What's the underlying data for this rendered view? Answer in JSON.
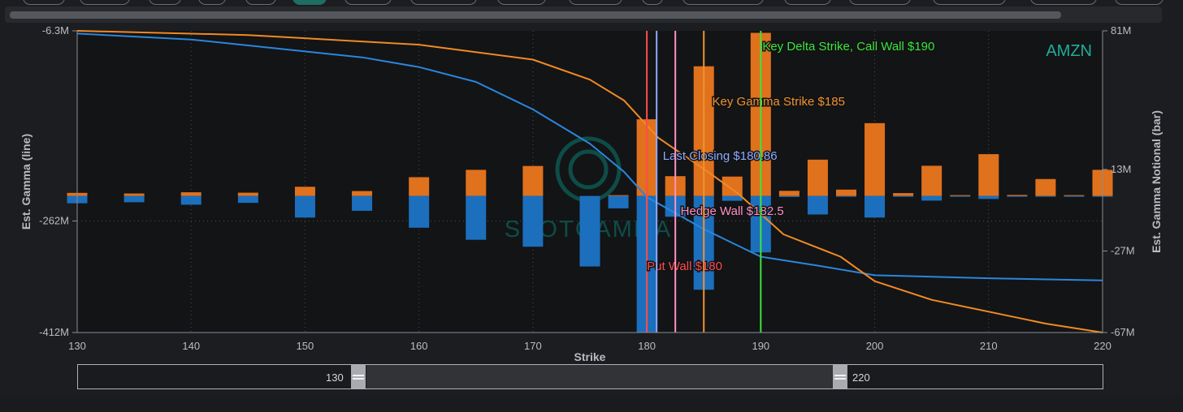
{
  "ticker": "AMZN",
  "watermark": "SPOTGAMMA",
  "navigator": {
    "min_label": "130",
    "max_label": "220"
  },
  "chart_data": {
    "type": "bar",
    "xlabel": "Strike",
    "ylabel_left": "Est. Gamma (line)",
    "ylabel_right": "Est. Gamma Notional (bar)",
    "xlim": [
      130,
      220
    ],
    "xticks": [
      130,
      140,
      150,
      160,
      170,
      180,
      190,
      200,
      210,
      220
    ],
    "ylim_left": [
      -412,
      -6.3
    ],
    "yticks_left": [
      "-6.3M",
      "-262M",
      "-412M"
    ],
    "ylim_right": [
      -67,
      81
    ],
    "yticks_right": [
      "81M",
      "13M",
      "-27M",
      "-67M"
    ],
    "grid": true,
    "colors": {
      "call_bar": "#e0711d",
      "put_bar": "#1c6fbd",
      "gamma_line": "#2a86dd",
      "notional_line": "#f08a24"
    },
    "strikes": [
      130,
      135,
      140,
      145,
      150,
      155,
      160,
      165,
      170,
      175,
      177.5,
      180,
      182.5,
      185,
      187.5,
      190,
      192.5,
      195,
      197.5,
      200,
      202.5,
      205,
      207.5,
      210,
      212.5,
      215,
      217.5,
      220
    ],
    "call_bar_values": [
      1.5,
      1.2,
      1.8,
      1.6,
      4.5,
      2.4,
      9.2,
      12.8,
      14.7,
      0,
      0.4,
      37.6,
      9.7,
      63.6,
      9.5,
      80.0,
      2.5,
      17.8,
      3.1,
      35.7,
      1.4,
      14.8,
      0.4,
      20.5,
      0.5,
      8.3,
      0.4,
      12.8
    ],
    "put_bar_values": [
      -3.6,
      -3.1,
      -4.3,
      -3.4,
      -10.6,
      -7.3,
      -15.6,
      -21.5,
      -24.9,
      -34.6,
      -6.1,
      -67.0,
      -10.2,
      -46.0,
      -2.4,
      -27.7,
      -0.5,
      -9.1,
      -0.2,
      -10.6,
      -0.2,
      -2.3,
      -0.2,
      -1.5,
      -0.1,
      -0.3,
      -0.1,
      -0.4
    ],
    "series": [
      {
        "name": "Est. Gamma (line)",
        "axis": "left",
        "x": [
          130,
          140,
          150,
          155,
          160,
          165,
          170,
          175,
          178,
          180,
          182,
          185,
          190,
          195,
          200,
          210,
          220
        ],
        "y": [
          -10,
          -18,
          -34,
          -42,
          -55,
          -75,
          -112,
          -158,
          -196,
          -230,
          -247,
          -273,
          -310,
          -322,
          -335,
          -339,
          -342
        ]
      },
      {
        "name": "Est. Gamma Notional (line)",
        "axis": "left",
        "x": [
          130,
          145,
          160,
          170,
          175,
          178,
          181,
          185,
          188,
          192,
          197,
          200,
          205,
          210,
          215,
          220
        ],
        "y": [
          -6.3,
          -12,
          -25,
          -45,
          -72,
          -100,
          -150,
          -192,
          -225,
          -280,
          -310,
          -343,
          -368,
          -384,
          -400,
          -412
        ]
      }
    ],
    "levels": [
      {
        "label": "Put Wall $180",
        "strike": 180,
        "color": "#ff4b4b"
      },
      {
        "label": "Last Closing $180.86",
        "strike": 180.86,
        "color": "#8fa8ff"
      },
      {
        "label": "Hedge Wall $182.5",
        "strike": 182.5,
        "color": "#ff8fc2"
      },
      {
        "label": "Key Gamma Strike $185",
        "strike": 185,
        "color": "#f0922f"
      },
      {
        "label": "Key Delta Strike, Call Wall $190",
        "strike": 190,
        "color": "#3be53b"
      }
    ]
  }
}
